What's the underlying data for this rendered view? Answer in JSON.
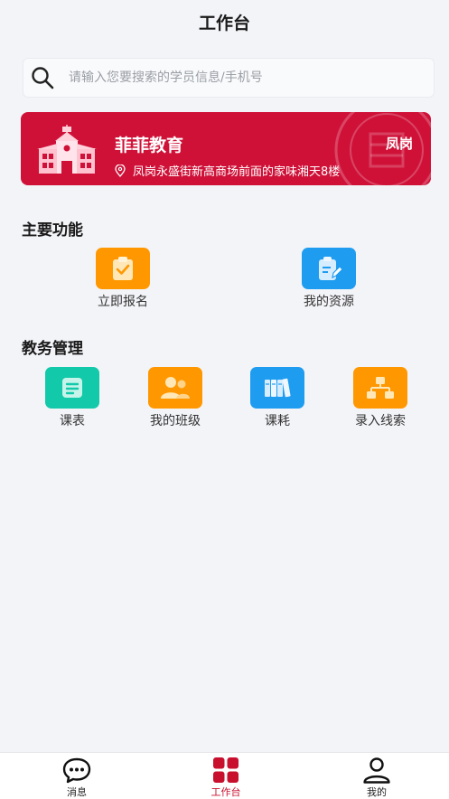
{
  "header": {
    "title": "工作台"
  },
  "search": {
    "placeholder": "请输入您要搜索的学员信息/手机号",
    "icon": "search-icon"
  },
  "banner": {
    "name": "菲菲教育",
    "region": "凤岗",
    "address": "凤岗永盛街新高商场前面的家味湘天8楼",
    "color": "#cf1138"
  },
  "main_functions": {
    "title": "主要功能",
    "items": [
      {
        "label": "立即报名",
        "icon": "clipboard-check-icon",
        "color": "#ff9800"
      },
      {
        "label": "我的资源",
        "icon": "document-edit-icon",
        "color": "#1e9cf0"
      }
    ]
  },
  "academic": {
    "title": "教务管理",
    "items": [
      {
        "label": "课表",
        "icon": "schedule-icon",
        "color": "#12c9a9"
      },
      {
        "label": "我的班级",
        "icon": "class-group-icon",
        "color": "#ff9800"
      },
      {
        "label": "课耗",
        "icon": "books-icon",
        "color": "#1e9cf0"
      },
      {
        "label": "录入线索",
        "icon": "org-chart-icon",
        "color": "#ff9800"
      }
    ]
  },
  "tabbar": {
    "items": [
      {
        "label": "消息",
        "icon": "message-icon",
        "active": false
      },
      {
        "label": "工作台",
        "icon": "workbench-grid-icon",
        "active": true
      },
      {
        "label": "我的",
        "icon": "user-icon",
        "active": false
      }
    ],
    "active_color": "#c8102e"
  }
}
